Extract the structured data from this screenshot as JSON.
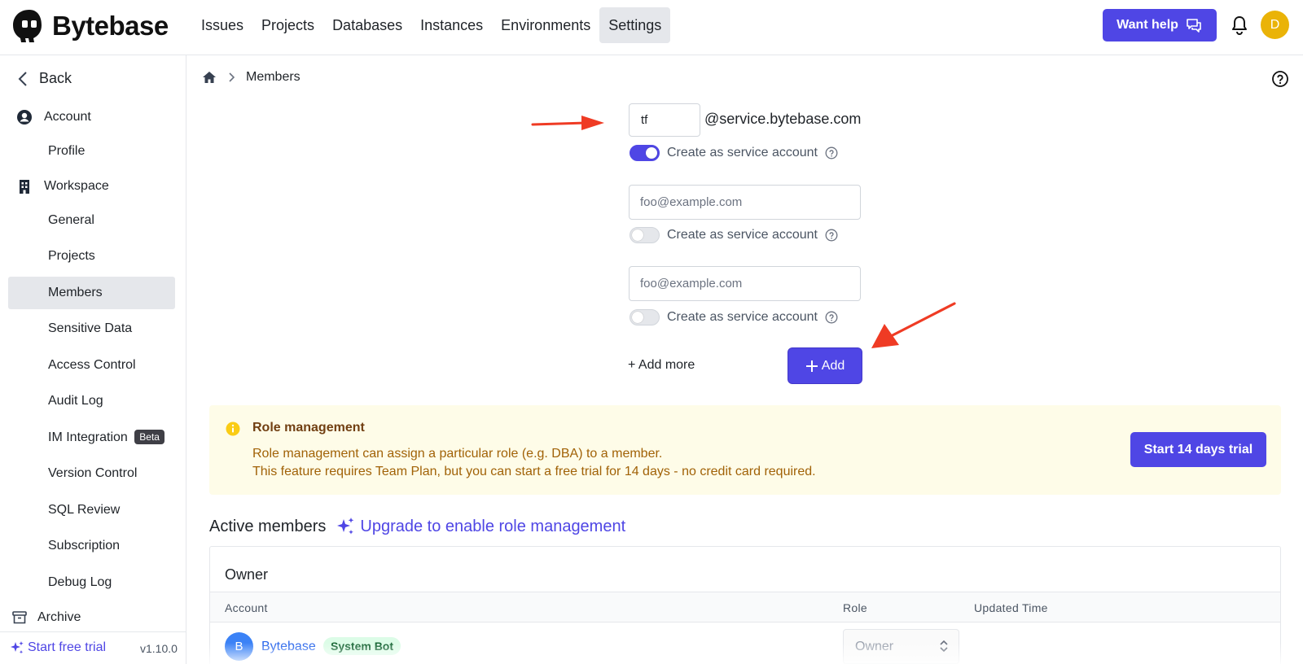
{
  "app": {
    "name": "Bytebase"
  },
  "nav": [
    {
      "label": "Issues"
    },
    {
      "label": "Projects"
    },
    {
      "label": "Databases"
    },
    {
      "label": "Instances"
    },
    {
      "label": "Environments"
    },
    {
      "label": "Settings",
      "active": true
    }
  ],
  "header": {
    "help_label": "Want help",
    "user_initial": "D"
  },
  "sidebar": {
    "back_label": "Back",
    "account_label": "Account",
    "profile_label": "Profile",
    "workspace_label": "Workspace",
    "items": [
      {
        "label": "General"
      },
      {
        "label": "Projects"
      },
      {
        "label": "Members",
        "active": true
      },
      {
        "label": "Sensitive Data"
      },
      {
        "label": "Access Control"
      },
      {
        "label": "Audit Log"
      },
      {
        "label": "IM Integration",
        "badge": "Beta"
      },
      {
        "label": "Version Control"
      },
      {
        "label": "SQL Review"
      },
      {
        "label": "Subscription"
      },
      {
        "label": "Debug Log"
      }
    ],
    "archive_label": "Archive",
    "trial_label": "Start free trial",
    "version": "v1.10.0"
  },
  "breadcrumb": {
    "current": "Members"
  },
  "invite": {
    "prefix_value": "tf",
    "domain": "@service.bytebase.com",
    "service_label": "Create as service account",
    "placeholder": "foo@example.com",
    "add_more_label": "+ Add more",
    "add_label": "Add"
  },
  "banner": {
    "title": "Role management",
    "line1": "Role management can assign a particular role (e.g. DBA) to a member.",
    "line2": "This feature requires Team Plan, but you can start a free trial for 14 days - no credit card required.",
    "trial_button": "Start 14 days trial"
  },
  "members": {
    "heading": "Active members",
    "upgrade_label": "Upgrade to enable role management",
    "owner_heading": "Owner",
    "columns": [
      "Account",
      "Role",
      "Updated Time"
    ],
    "rows": [
      {
        "initial": "B",
        "name": "Bytebase",
        "badge": "System Bot",
        "role": "Owner"
      }
    ]
  },
  "colors": {
    "accent": "#4f46e5",
    "banner_bg": "#fefce8",
    "arrow": "#ef3b24"
  }
}
